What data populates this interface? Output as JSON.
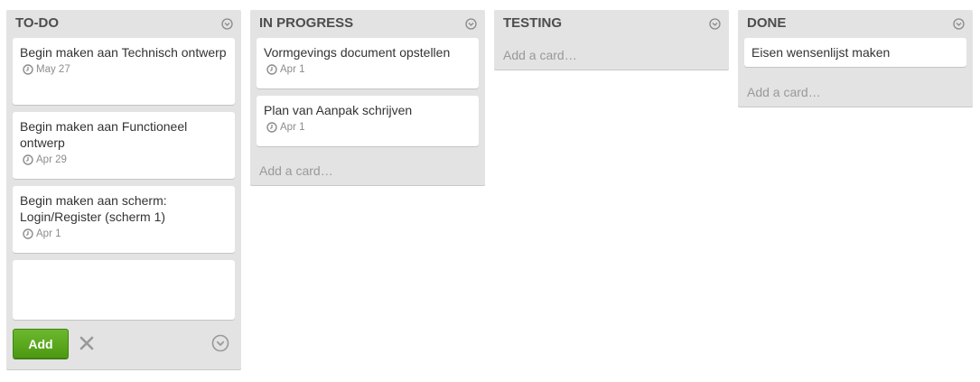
{
  "lists": [
    {
      "title": "TO-DO",
      "cards": [
        {
          "title": "Begin maken aan Technisch ontwerp",
          "due": "May 27"
        },
        {
          "title": "Begin maken aan Functioneel ontwerp",
          "due": "Apr 29"
        },
        {
          "title": "Begin maken aan scherm: Login/Register (scherm 1)",
          "due": "Apr 1"
        }
      ],
      "composer": {
        "text": "",
        "add_label": "Add"
      }
    },
    {
      "title": "IN PROGRESS",
      "cards": [
        {
          "title": "Vormgevings document opstellen",
          "due": "Apr 1"
        },
        {
          "title": "Plan van Aanpak schrijven",
          "due": "Apr 1"
        }
      ],
      "add_card_label": "Add a card…"
    },
    {
      "title": "TESTING",
      "cards": [],
      "add_card_label": "Add a card…"
    },
    {
      "title": "DONE",
      "cards": [
        {
          "title": "Eisen wensenlijst maken"
        }
      ],
      "add_card_label": "Add a card…"
    }
  ],
  "icons": {
    "list_menu": "chevron-circle-down-icon",
    "due_date": "clock-icon",
    "close": "close-icon"
  },
  "colors": {
    "list_bg": "#e3e3e3",
    "add_button": "#5aa81d",
    "muted_text": "#999999"
  }
}
